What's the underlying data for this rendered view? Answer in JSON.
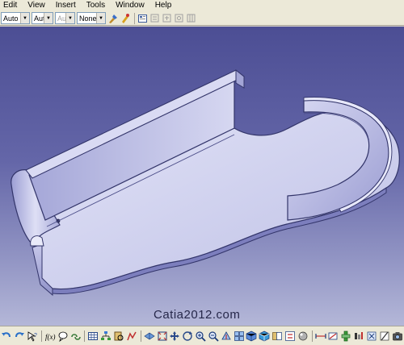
{
  "menu": {
    "edit": "Edit",
    "view": "View",
    "insert": "Insert",
    "tools": "Tools",
    "window": "Window",
    "help": "Help"
  },
  "properties": {
    "color": "Auto",
    "transparency": "Aut",
    "thickness": "Aut",
    "linetype": "None"
  },
  "watermark": "Catia2012.com",
  "colors": {
    "part_face": "#c9cae9",
    "part_shadow": "#8f90c8",
    "background_top": "#4c4e94",
    "background_bottom": "#b4b7d8"
  }
}
